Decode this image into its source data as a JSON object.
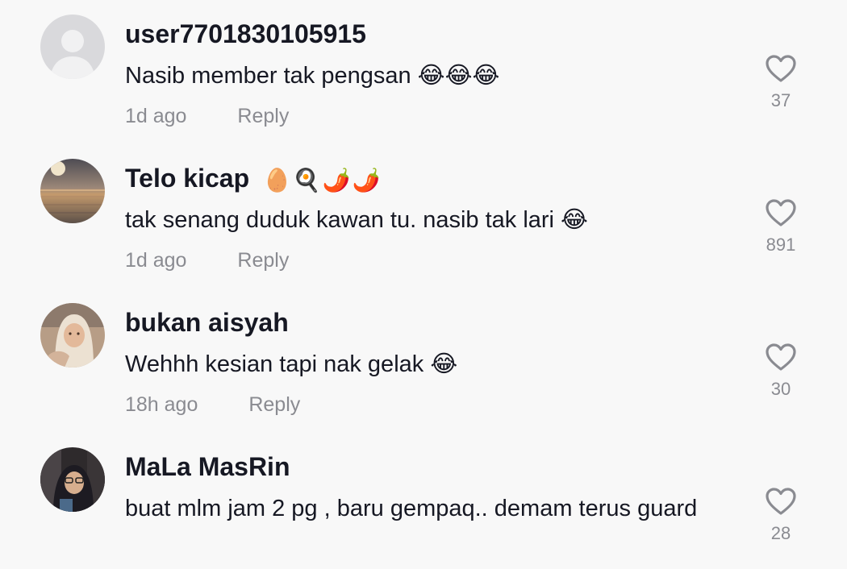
{
  "comments": [
    {
      "username": "user7701830105915",
      "name_emoji": "",
      "text": "Nasib member tak pengsan 😂😂😂",
      "time": "1d ago",
      "reply_label": "Reply",
      "likes": "37",
      "avatar_icon": "default-user-avatar"
    },
    {
      "username": "Telo kicap",
      "name_emoji": "🥚🍳🌶️🌶️",
      "text": "tak senang duduk kawan tu. nasib tak lari 😂",
      "time": "1d ago",
      "reply_label": "Reply",
      "likes": "891",
      "avatar_icon": "sunset-sea-photo"
    },
    {
      "username": "bukan aisyah",
      "name_emoji": "",
      "text": "Wehhh kesian tapi nak gelak 😂",
      "time": "18h ago",
      "reply_label": "Reply",
      "likes": "30",
      "avatar_icon": "person-hijab-photo"
    },
    {
      "username": "MaLa MasRin",
      "name_emoji": "",
      "text": "buat mlm jam 2 pg , baru gempaq.. demam terus guard",
      "time": "",
      "reply_label": "",
      "likes": "28",
      "avatar_icon": "person-car-selfie-photo"
    }
  ],
  "icons": {
    "like": "heart-outline-icon"
  },
  "colors": {
    "background": "#f8f8f8",
    "primary_text": "#161823",
    "secondary_text": "#8a8b91"
  }
}
